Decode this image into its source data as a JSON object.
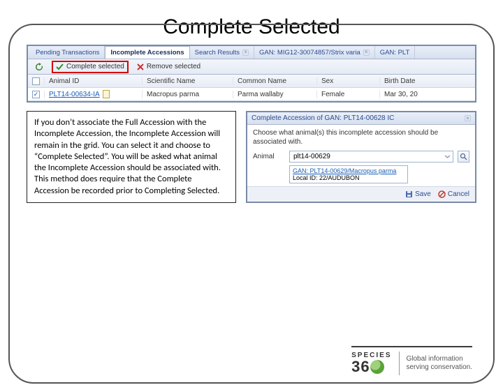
{
  "title": "Complete Selected",
  "tabs": {
    "pending": "Pending Transactions",
    "incomplete": "Incomplete Accessions",
    "search": "Search Results",
    "gan1": "GAN: MIG12-30074857/Strix varia",
    "gan2": "GAN: PLT"
  },
  "toolbar": {
    "complete": "Complete selected",
    "remove": "Remove selected"
  },
  "grid": {
    "headers": {
      "animal_id": "Animal ID",
      "sci": "Scientific Name",
      "common": "Common Name",
      "sex": "Sex",
      "birth": "Birth Date"
    },
    "row": {
      "id": "PLT14-00634-IA",
      "sci": "Macropus parma",
      "common": "Parma wallaby",
      "sex": "Female",
      "birth": "Mar 30, 20"
    }
  },
  "explain": "If you don’t associate the Full Accession with the Incomplete Accession, the Incomplete Accession will remain in the grid. You can select it and choose to “Complete Selected”. You will be asked what animal the Incomplete Accession should be associated with. This method does require that the Complete Accession be recorded prior to Completing Selected.",
  "dialog": {
    "title": "Complete Accession of GAN: PLT14-00628 IC",
    "instruction": "Choose what animal(s) this incomplete accession should be associated with.",
    "animal_label": "Animal",
    "animal_value": "plt14-00629",
    "result_line1": "GAN: PLT14-00629/Macropus parma",
    "result_line2": "Local ID: 22/AUDUBON",
    "save": "Save",
    "cancel": "Cancel"
  },
  "brand": {
    "species": "SPECIES",
    "tagline1": "Global information",
    "tagline2": "serving conservation."
  }
}
